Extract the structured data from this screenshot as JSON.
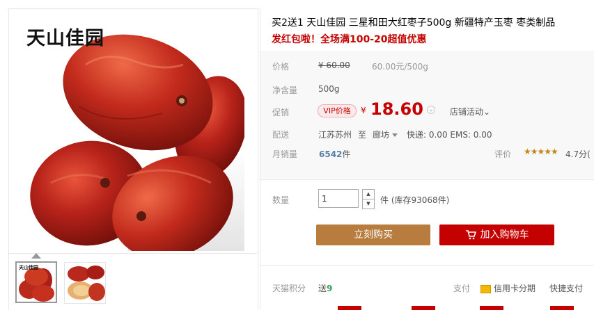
{
  "brand_logo": "天山佳园",
  "product": {
    "title": "买2送1 天山佳园 三星和田大红枣子500g 新疆特产玉枣 枣类制品",
    "promo": "发红包啦！全场满100-20超值优惠"
  },
  "price": {
    "label": "价格",
    "original": "¥ 60.00",
    "unit_price": "60.00元/500g"
  },
  "weight": {
    "label": "净含量",
    "value": "500g"
  },
  "promotion": {
    "label": "促销",
    "vip_badge": "VIP价格",
    "currency": "¥",
    "value": "18.60",
    "store_event": "店铺活动"
  },
  "shipping": {
    "label": "配送",
    "from": "江苏苏州",
    "to_word": "至",
    "to": "廊坊",
    "fee": "快递: 0.00 EMS: 0.00"
  },
  "sales": {
    "label": "月销量",
    "count": "6542",
    "unit": "件"
  },
  "rating": {
    "label": "评价",
    "stars": "★★★★★",
    "score": "4.7分(",
    "colors": {
      "star": "#c4881a"
    }
  },
  "quantity": {
    "label": "数量",
    "value": "1",
    "unit": "件 (库存93068件)"
  },
  "buttons": {
    "buy_now": "立刻购买",
    "add_cart": "加入购物车"
  },
  "points": {
    "label": "天猫积分",
    "value_prefix": "送",
    "value": "9",
    "pay_label": "支付",
    "credit": "信用卡分期",
    "fast": "快捷支付"
  },
  "theme": {
    "accent": "#c40000",
    "buy": "#b87d3e"
  }
}
